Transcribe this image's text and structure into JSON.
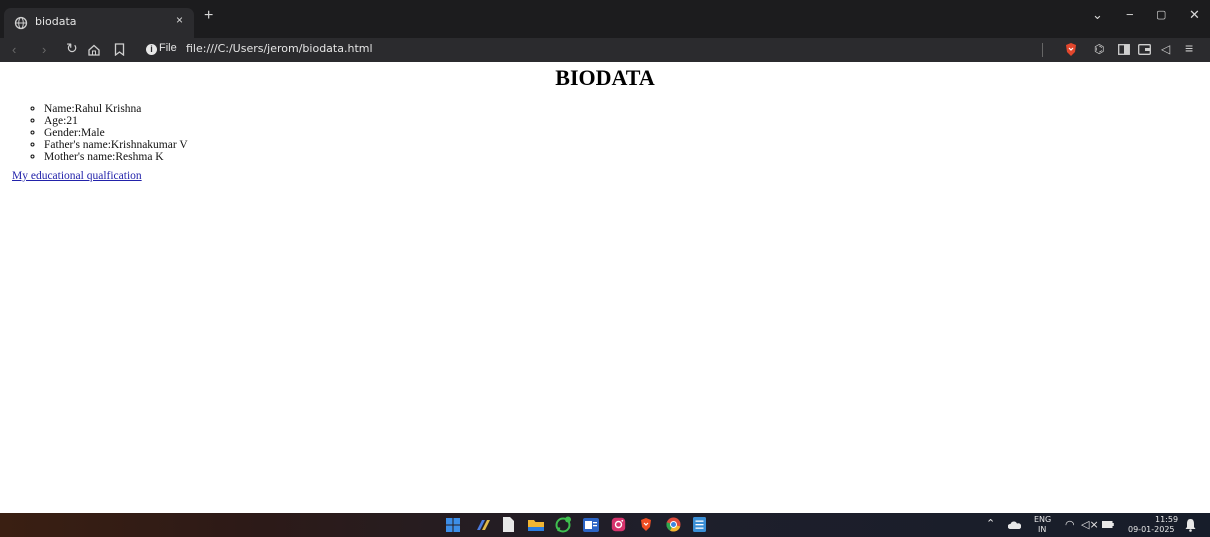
{
  "browser": {
    "tab_title": "biodata",
    "close_symbol": "×",
    "new_tab_symbol": "+",
    "security_label": "File",
    "url": "file:///C:/Users/jerom/biodata.html"
  },
  "page": {
    "heading": "BIODATA",
    "items": [
      "Name:Rahul Krishna",
      "Age:21",
      "Gender:Male",
      "Father's name:Krishnakumar V",
      "Mother's name:Reshma K"
    ],
    "link_text": "My educational qualfication"
  },
  "taskbar": {
    "lang_line1": "ENG",
    "lang_line2": "IN",
    "time": "11:59",
    "date": "09-01-2025"
  },
  "icons": {
    "taskbar": [
      "windows-start-icon",
      "copilot-icon",
      "notepad-icon",
      "file-explorer-icon",
      "whatsapp-icon",
      "word-icon",
      "instagram-icon",
      "brave-icon",
      "chrome-icon",
      "notes-icon"
    ],
    "colors": {
      "start": "#3d8ee8",
      "copilot": "#4b7be0",
      "notepad": "#e8e8e8",
      "explorer": "#f2b632",
      "whatsapp": "#3fbf4f",
      "word": "#2b64c5",
      "instagram": "#d6336c",
      "brave": "#f04e23",
      "chrome": "#f0b72f",
      "notes": "#3a8fd6"
    }
  }
}
